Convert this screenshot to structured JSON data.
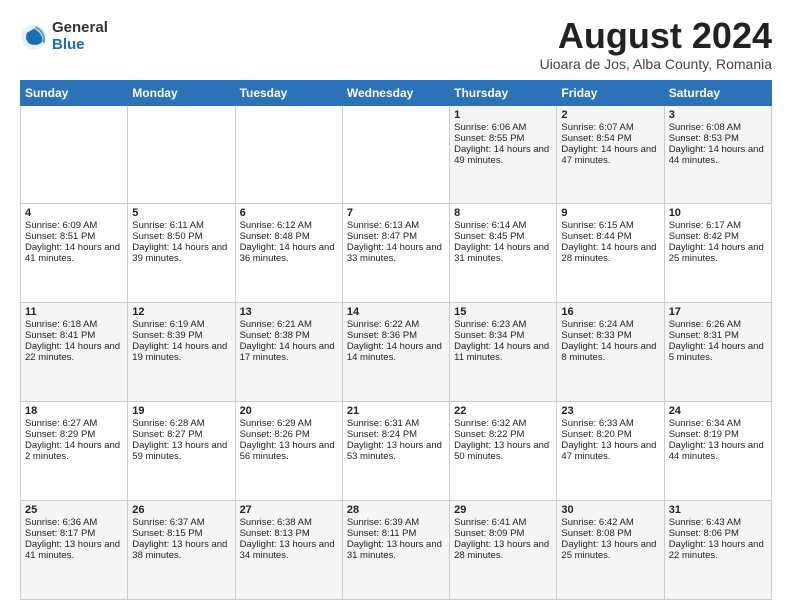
{
  "logo": {
    "general": "General",
    "blue": "Blue"
  },
  "title": "August 2024",
  "location": "Uioara de Jos, Alba County, Romania",
  "days_of_week": [
    "Sunday",
    "Monday",
    "Tuesday",
    "Wednesday",
    "Thursday",
    "Friday",
    "Saturday"
  ],
  "weeks": [
    [
      {
        "day": "",
        "content": ""
      },
      {
        "day": "",
        "content": ""
      },
      {
        "day": "",
        "content": ""
      },
      {
        "day": "",
        "content": ""
      },
      {
        "day": "1",
        "content": "Sunrise: 6:06 AM\nSunset: 8:55 PM\nDaylight: 14 hours and 49 minutes."
      },
      {
        "day": "2",
        "content": "Sunrise: 6:07 AM\nSunset: 8:54 PM\nDaylight: 14 hours and 47 minutes."
      },
      {
        "day": "3",
        "content": "Sunrise: 6:08 AM\nSunset: 8:53 PM\nDaylight: 14 hours and 44 minutes."
      }
    ],
    [
      {
        "day": "4",
        "content": "Sunrise: 6:09 AM\nSunset: 8:51 PM\nDaylight: 14 hours and 41 minutes."
      },
      {
        "day": "5",
        "content": "Sunrise: 6:11 AM\nSunset: 8:50 PM\nDaylight: 14 hours and 39 minutes."
      },
      {
        "day": "6",
        "content": "Sunrise: 6:12 AM\nSunset: 8:48 PM\nDaylight: 14 hours and 36 minutes."
      },
      {
        "day": "7",
        "content": "Sunrise: 6:13 AM\nSunset: 8:47 PM\nDaylight: 14 hours and 33 minutes."
      },
      {
        "day": "8",
        "content": "Sunrise: 6:14 AM\nSunset: 8:45 PM\nDaylight: 14 hours and 31 minutes."
      },
      {
        "day": "9",
        "content": "Sunrise: 6:15 AM\nSunset: 8:44 PM\nDaylight: 14 hours and 28 minutes."
      },
      {
        "day": "10",
        "content": "Sunrise: 6:17 AM\nSunset: 8:42 PM\nDaylight: 14 hours and 25 minutes."
      }
    ],
    [
      {
        "day": "11",
        "content": "Sunrise: 6:18 AM\nSunset: 8:41 PM\nDaylight: 14 hours and 22 minutes."
      },
      {
        "day": "12",
        "content": "Sunrise: 6:19 AM\nSunset: 8:39 PM\nDaylight: 14 hours and 19 minutes."
      },
      {
        "day": "13",
        "content": "Sunrise: 6:21 AM\nSunset: 8:38 PM\nDaylight: 14 hours and 17 minutes."
      },
      {
        "day": "14",
        "content": "Sunrise: 6:22 AM\nSunset: 8:36 PM\nDaylight: 14 hours and 14 minutes."
      },
      {
        "day": "15",
        "content": "Sunrise: 6:23 AM\nSunset: 8:34 PM\nDaylight: 14 hours and 11 minutes."
      },
      {
        "day": "16",
        "content": "Sunrise: 6:24 AM\nSunset: 8:33 PM\nDaylight: 14 hours and 8 minutes."
      },
      {
        "day": "17",
        "content": "Sunrise: 6:26 AM\nSunset: 8:31 PM\nDaylight: 14 hours and 5 minutes."
      }
    ],
    [
      {
        "day": "18",
        "content": "Sunrise: 6:27 AM\nSunset: 8:29 PM\nDaylight: 14 hours and 2 minutes."
      },
      {
        "day": "19",
        "content": "Sunrise: 6:28 AM\nSunset: 8:27 PM\nDaylight: 13 hours and 59 minutes."
      },
      {
        "day": "20",
        "content": "Sunrise: 6:29 AM\nSunset: 8:26 PM\nDaylight: 13 hours and 56 minutes."
      },
      {
        "day": "21",
        "content": "Sunrise: 6:31 AM\nSunset: 8:24 PM\nDaylight: 13 hours and 53 minutes."
      },
      {
        "day": "22",
        "content": "Sunrise: 6:32 AM\nSunset: 8:22 PM\nDaylight: 13 hours and 50 minutes."
      },
      {
        "day": "23",
        "content": "Sunrise: 6:33 AM\nSunset: 8:20 PM\nDaylight: 13 hours and 47 minutes."
      },
      {
        "day": "24",
        "content": "Sunrise: 6:34 AM\nSunset: 8:19 PM\nDaylight: 13 hours and 44 minutes."
      }
    ],
    [
      {
        "day": "25",
        "content": "Sunrise: 6:36 AM\nSunset: 8:17 PM\nDaylight: 13 hours and 41 minutes."
      },
      {
        "day": "26",
        "content": "Sunrise: 6:37 AM\nSunset: 8:15 PM\nDaylight: 13 hours and 38 minutes."
      },
      {
        "day": "27",
        "content": "Sunrise: 6:38 AM\nSunset: 8:13 PM\nDaylight: 13 hours and 34 minutes."
      },
      {
        "day": "28",
        "content": "Sunrise: 6:39 AM\nSunset: 8:11 PM\nDaylight: 13 hours and 31 minutes."
      },
      {
        "day": "29",
        "content": "Sunrise: 6:41 AM\nSunset: 8:09 PM\nDaylight: 13 hours and 28 minutes."
      },
      {
        "day": "30",
        "content": "Sunrise: 6:42 AM\nSunset: 8:08 PM\nDaylight: 13 hours and 25 minutes."
      },
      {
        "day": "31",
        "content": "Sunrise: 6:43 AM\nSunset: 8:06 PM\nDaylight: 13 hours and 22 minutes."
      }
    ]
  ]
}
